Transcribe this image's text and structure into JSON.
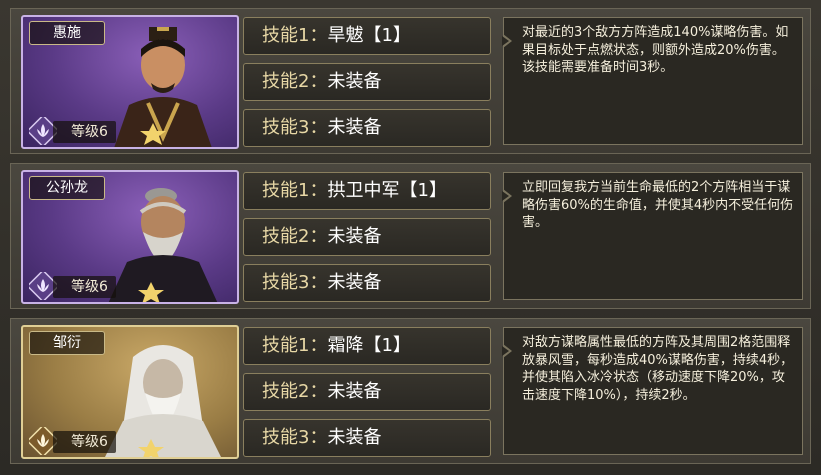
{
  "rows": [
    {
      "name": "惠施",
      "level": "等级6",
      "theme": "purple",
      "skills": [
        {
          "label": "技能1：",
          "value": "旱魃【1】"
        },
        {
          "label": "技能2：",
          "value": "未装备"
        },
        {
          "label": "技能3：",
          "value": "未装备"
        }
      ],
      "description": "对最近的3个敌方方阵造成140%谋略伤害。如果目标处于点燃状态，则额外造成20%伤害。该技能需要准备时间3秒。"
    },
    {
      "name": "公孙龙",
      "level": "等级6",
      "theme": "purple",
      "skills": [
        {
          "label": "技能1：",
          "value": "拱卫中军【1】"
        },
        {
          "label": "技能2：",
          "value": "未装备"
        },
        {
          "label": "技能3：",
          "value": "未装备"
        }
      ],
      "description": "立即回复我方当前生命最低的2个方阵相当于谋略伤害60%的生命值，并使其4秒内不受任何伤害。"
    },
    {
      "name": "邹衍",
      "level": "等级6",
      "theme": "gold",
      "skills": [
        {
          "label": "技能1：",
          "value": "霜降【1】"
        },
        {
          "label": "技能2：",
          "value": "未装备"
        },
        {
          "label": "技能3：",
          "value": "未装备"
        }
      ],
      "description": "对敌方谋略属性最低的方阵及其周围2格范围释放暴风雪，每秒造成40%谋略伤害，持续4秒，并使其陷入冰冷状态（移动速度下降20%，攻击速度下降10%），持续2秒。"
    }
  ],
  "icons": {
    "level_badge": "lotus-icon"
  }
}
